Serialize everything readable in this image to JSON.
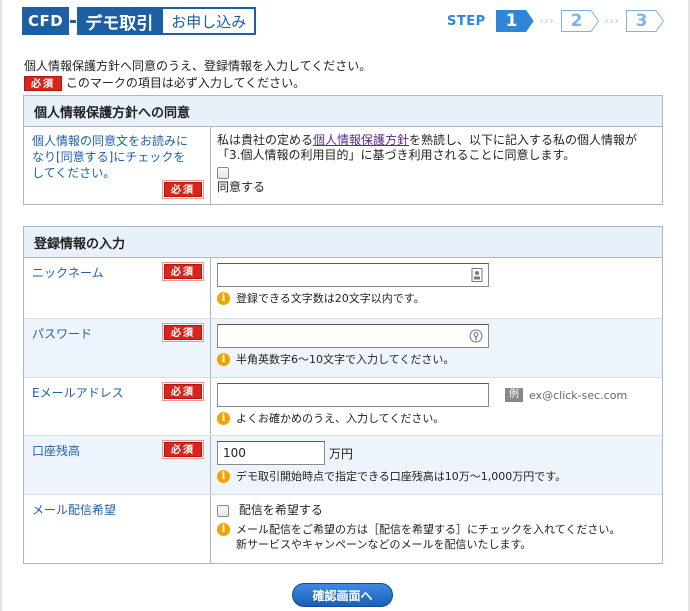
{
  "header": {
    "brand": "CFD",
    "demo_title": "デモ取引",
    "apply_label": "お申し込み",
    "step_label": "STEP",
    "steps": [
      "1",
      "2",
      "3"
    ],
    "active_step": 1
  },
  "intro": {
    "line1": "個人情報保護方針へ同意のうえ、登録情報を入力してください。",
    "required_badge": "必須",
    "line2": "このマークの項目は必ず入力してください。"
  },
  "privacy": {
    "title": "個人情報保護方針への同意",
    "label": "個人情報の同意文をお読みになり[同意する]にチェックをしてください。",
    "required_badge": "必須",
    "text_before_link": "私は貴社の定める",
    "link_text": "個人情報保護方針",
    "text_after_link": "を熟読し、以下に記入する私の個人情報が「3.個人情報の利用目的」に基づき利用されることに同意します。",
    "checkbox_label": "同意する"
  },
  "registration": {
    "title": "登録情報の入力",
    "nickname": {
      "label": "ニックネーム",
      "required_badge": "必須",
      "value": "",
      "info": "登録できる文字数は20文字以内です。"
    },
    "password": {
      "label": "パスワード",
      "required_badge": "必須",
      "value": "",
      "info": "半角英数字6～10文字で入力してください。"
    },
    "email": {
      "label": "Eメールアドレス",
      "required_badge": "必須",
      "value": "",
      "example_badge": "例",
      "example": "ex@click-sec.com",
      "info": "よくお確かめのうえ、入力してください。"
    },
    "balance": {
      "label": "口座残高",
      "required_badge": "必須",
      "value": "100",
      "unit": "万円",
      "info": "デモ取引開始時点で指定できる口座残高は10万～1,000万円です。"
    },
    "newsletter": {
      "label": "メール配信希望",
      "checkbox_label": "配信を希望する",
      "info_line1": "メール配信をご希望の方は［配信を希望する］にチェックを入れてください。",
      "info_line2": "新サービスやキャンペーンなどのメールを配信いたします。"
    }
  },
  "submit_label": "確認画面へ",
  "colors": {
    "brand_blue": "#1d5fa3",
    "step_active": "#2f86d9",
    "required_red": "#d9261c",
    "info_orange": "#f0a400",
    "section_header_bg": "#e8f0fa"
  }
}
